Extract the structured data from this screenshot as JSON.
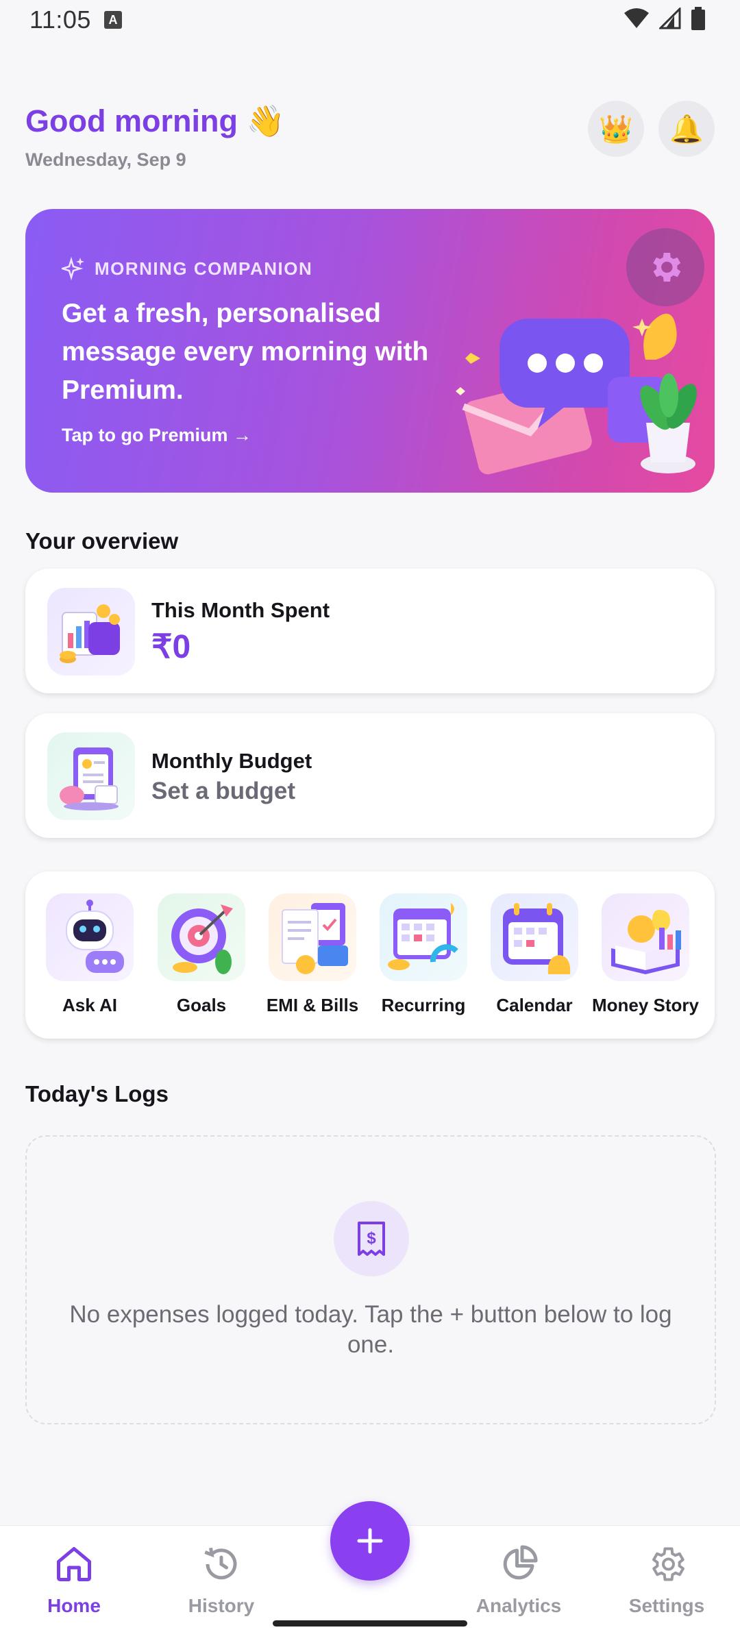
{
  "status_bar": {
    "time": "11:05",
    "notification_glyph": "A"
  },
  "header": {
    "greeting": "Good morning 👋",
    "date": "Wednesday, Sep 9",
    "crown_icon": "crown-icon",
    "bell_icon": "bell-icon"
  },
  "banner": {
    "tag": "MORNING COMPANION",
    "title": "Get a fresh, personalised message every morning with Premium.",
    "cta": "Tap to go Premium →",
    "gradient_start": "#8a5cf4",
    "gradient_end": "#e64aa0"
  },
  "overview": {
    "title": "Your overview",
    "spent": {
      "label": "This Month Spent",
      "value": "₹0"
    },
    "budget": {
      "label": "Monthly Budget",
      "value": "Set a budget"
    }
  },
  "quick_actions": [
    {
      "label": "Ask AI",
      "icon": "robot-icon"
    },
    {
      "label": "Goals",
      "icon": "target-icon"
    },
    {
      "label": "EMI & Bills",
      "icon": "bill-icon"
    },
    {
      "label": "Recurring",
      "icon": "recurring-calendar-icon"
    },
    {
      "label": "Calendar",
      "icon": "calendar-icon"
    },
    {
      "label": "Money Story",
      "icon": "book-icon"
    }
  ],
  "logs": {
    "title": "Today's Logs",
    "empty_message": "No expenses logged today. Tap the + button below to log one."
  },
  "bottom_nav": [
    {
      "label": "Home",
      "active": true
    },
    {
      "label": "History",
      "active": false
    },
    {
      "label": "Analytics",
      "active": false
    },
    {
      "label": "Settings",
      "active": false
    }
  ],
  "colors": {
    "accent": "#7b3fe4",
    "fab": "#8a3ff0",
    "inactive": "#9a9aa3"
  }
}
